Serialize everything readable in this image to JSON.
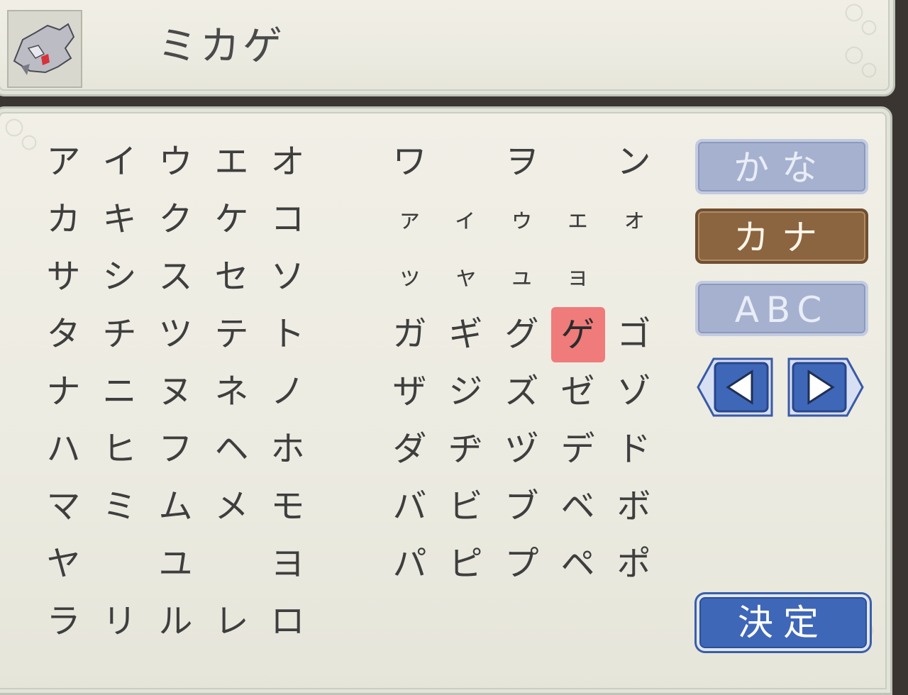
{
  "name_entry": {
    "value": "ミカゲ"
  },
  "kana_table": {
    "left": [
      [
        "ア",
        "イ",
        "ウ",
        "エ",
        "オ"
      ],
      [
        "カ",
        "キ",
        "ク",
        "ケ",
        "コ"
      ],
      [
        "サ",
        "シ",
        "ス",
        "セ",
        "ソ"
      ],
      [
        "タ",
        "チ",
        "ツ",
        "テ",
        "ト"
      ],
      [
        "ナ",
        "ニ",
        "ヌ",
        "ネ",
        "ノ"
      ],
      [
        "ハ",
        "ヒ",
        "フ",
        "ヘ",
        "ホ"
      ],
      [
        "マ",
        "ミ",
        "ム",
        "メ",
        "モ"
      ],
      [
        "ヤ",
        "",
        "ユ",
        "",
        "ヨ"
      ],
      [
        "ラ",
        "リ",
        "ル",
        "レ",
        "ロ"
      ]
    ],
    "right": [
      [
        "ワ",
        "",
        "ヲ",
        "",
        "ン"
      ],
      [
        "ァ",
        "ィ",
        "ゥ",
        "ェ",
        "ォ"
      ],
      [
        "ッ",
        "ャ",
        "ュ",
        "ョ",
        ""
      ],
      [
        "ガ",
        "ギ",
        "グ",
        "ゲ",
        "ゴ"
      ],
      [
        "ザ",
        "ジ",
        "ズ",
        "ゼ",
        "ゾ"
      ],
      [
        "ダ",
        "ヂ",
        "ヅ",
        "デ",
        "ド"
      ],
      [
        "バ",
        "ビ",
        "ブ",
        "ベ",
        "ボ"
      ],
      [
        "パ",
        "ピ",
        "プ",
        "ペ",
        "ポ"
      ]
    ],
    "selected": "ゲ"
  },
  "modes": {
    "hiragana": "かな",
    "katakana": "カナ",
    "alphabet": "ABC",
    "active": "katakana"
  },
  "confirm_label": "決定",
  "icons": {
    "avatar": "pokemon-avatar-icon",
    "left": "arrow-left-icon",
    "right": "arrow-right-icon"
  },
  "colors": {
    "selected_key": "#ef7b7b",
    "active_mode": "#8b6440",
    "inactive_mode": "#a6b1cf",
    "confirm": "#3f67b8"
  }
}
